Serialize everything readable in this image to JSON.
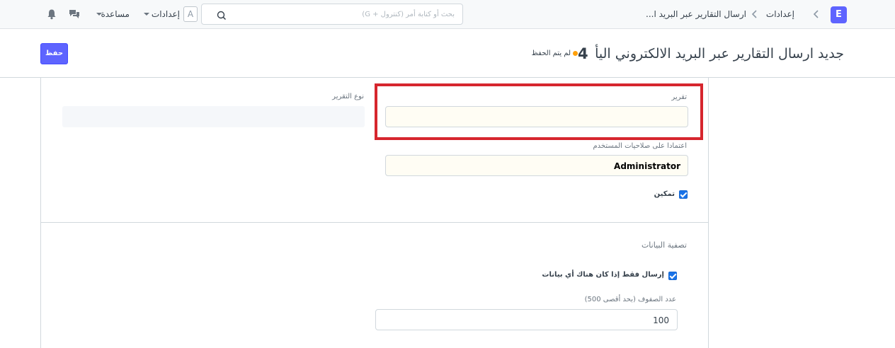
{
  "navbar": {
    "logo_letter": "E",
    "breadcrumbs": [
      "إعدادات",
      "ارسال التقارير عبر البريد ا..."
    ],
    "search": {
      "placeholder": "بحث أو كتابة أمر (كنترول + G)"
    },
    "avatar_letter": "A",
    "settings_menu_label": "إعدادات",
    "help_menu_label": "مساعدة"
  },
  "page_head": {
    "title": "جديد ارسال التقارير عبر البريد الالكتروني اليأ",
    "title_suffix": "4",
    "unsaved_label": "لم يتم الحفظ",
    "save_label": "حفظ"
  },
  "form": {
    "report_label": "تقرير",
    "report_value": "",
    "report_type_label": "نوع التقرير",
    "user_perm_label": "اعتمادا على صلاحيات المستخدم",
    "user_perm_value": "Administrator",
    "enabled_label": "تمكين",
    "enabled_checked": true,
    "filter_section_title": "تصفية البيانات",
    "send_if_data_label": "إرسال فقط إذا كان هناك أي بيانات",
    "send_if_data_checked": true,
    "no_of_rows_label": "عدد الصفوف (بحد أقصى 500)",
    "no_of_rows_value": "100"
  },
  "colors": {
    "primary": "#5e64ff",
    "unsaved_indicator": "#ffa00a",
    "highlight": "#d6262e"
  }
}
